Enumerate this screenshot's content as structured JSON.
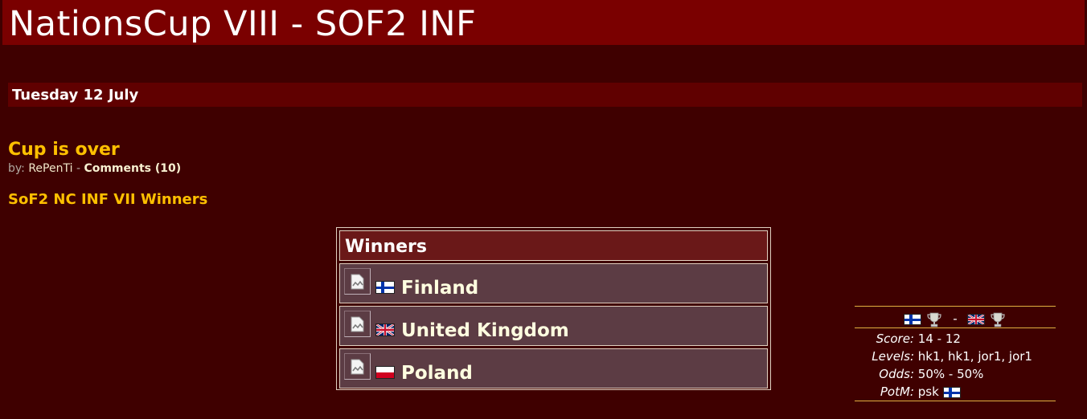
{
  "header": {
    "title": "NationsCup VIII - SOF2 INF"
  },
  "date_bar": {
    "text": "Tuesday 12 July"
  },
  "news": {
    "title": "Cup is over",
    "by_label": "by:",
    "author": "RePenTi",
    "separator": "-",
    "comments_label": "Comments (10)",
    "subheading": "SoF2 NC INF VII Winners"
  },
  "winners": {
    "header": "Winners",
    "rows": [
      {
        "country": "Finland",
        "flag": "finland-flag"
      },
      {
        "country": "United Kingdom",
        "flag": "uk-flag"
      },
      {
        "country": "Poland",
        "flag": "poland-flag"
      }
    ]
  },
  "match": {
    "team1_flag": "finland-flag",
    "team2_flag": "uk-flag",
    "trophy_icon": "trophy-icon",
    "versus": "-",
    "score_label": "Score:",
    "score": "14 - 12",
    "levels_label": "Levels:",
    "levels": "hk1, hk1, jor1, jor1",
    "odds_label": "Odds:",
    "odds": "50% - 50%",
    "potm_label": "PotM:",
    "potm": "psk",
    "potm_flag": "finland-flag"
  },
  "colors": {
    "background": "#3f0000",
    "header_bg": "#7a0000",
    "date_bar_bg": "#600000",
    "accent_gold": "#ffc000",
    "winners_header_bg": "#6a1818",
    "winner_row_bg": "#5c3c44",
    "divider": "#e0b040"
  }
}
